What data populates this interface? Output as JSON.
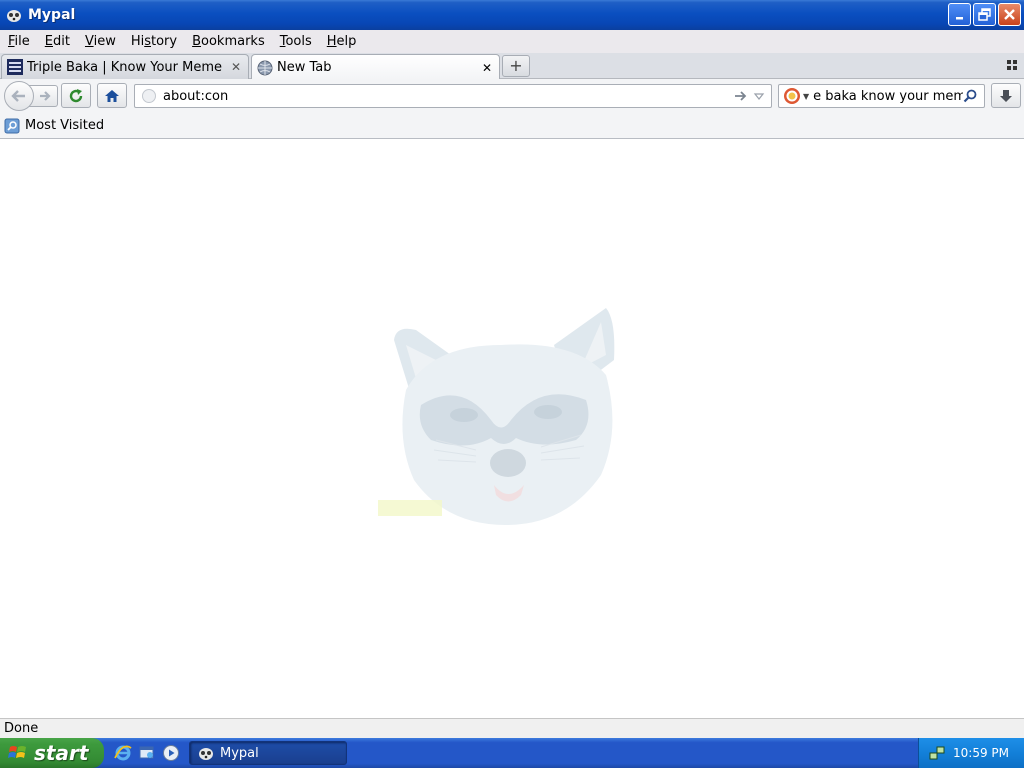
{
  "window": {
    "title": "Mypal"
  },
  "menu": [
    "File",
    "Edit",
    "View",
    "History",
    "Bookmarks",
    "Tools",
    "Help"
  ],
  "menu_underlines": [
    "F",
    "E",
    "V",
    "s",
    "B",
    "T",
    "H"
  ],
  "tabs": [
    {
      "label": "Triple Baka | Know Your Meme",
      "active": false
    },
    {
      "label": "New Tab",
      "active": true
    }
  ],
  "urlbar": {
    "value": "about:con"
  },
  "searchbar": {
    "value": "e baka know your meme"
  },
  "bookmarks": {
    "item": "Most Visited"
  },
  "status": {
    "text": "Done"
  },
  "taskbar": {
    "start_label": "start",
    "task_label": "Mypal",
    "clock": "10:59 PM"
  },
  "content": {
    "image_caption": ""
  }
}
